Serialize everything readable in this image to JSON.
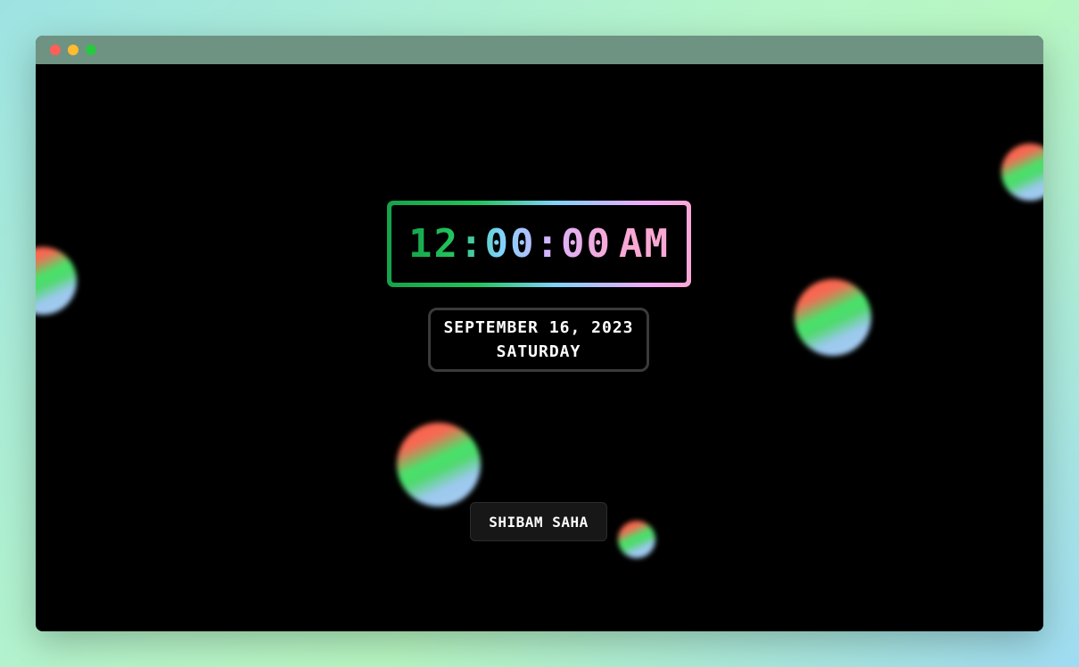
{
  "window": {
    "controls": [
      "close",
      "minimize",
      "maximize"
    ]
  },
  "clock": {
    "time": "12:00:00",
    "ampm": "AM"
  },
  "date": {
    "full_date": "SEPTEMBER 16, 2023",
    "weekday": "SATURDAY"
  },
  "author": {
    "name": "SHIBAM SAHA"
  },
  "colors": {
    "background": "#000000",
    "titlebar": "#6f9382",
    "clock_gradient_start": "#16a34a",
    "clock_gradient_mid": "#7dd3fc",
    "clock_gradient_end": "#f9a8d4",
    "orb_red": "#ff5a47",
    "orb_green": "#46e36a",
    "orb_blue": "#a9cff3"
  }
}
